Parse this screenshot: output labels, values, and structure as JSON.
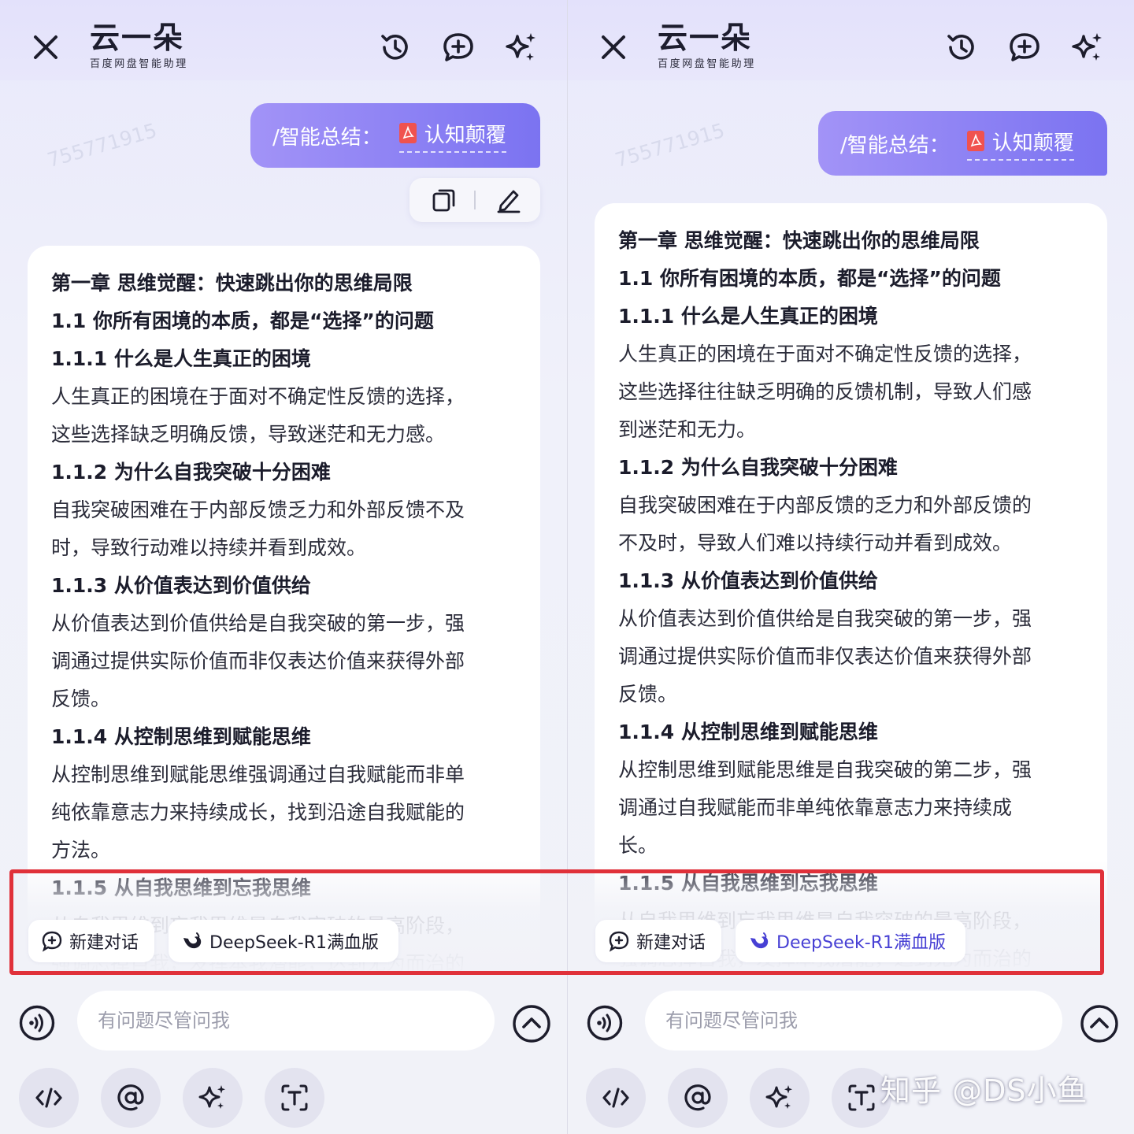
{
  "app": {
    "brand_name": "云一朵",
    "brand_subtitle": "百度网盘智能助理"
  },
  "colors": {
    "accent": "#7b73f1",
    "accent_light": "#a293f7",
    "deepseek_blue": "#4740d4",
    "highlight_border": "#e0313a"
  },
  "icons": {
    "close": "close-icon",
    "history": "history-icon",
    "new_chat": "chat-plus-icon",
    "sparkle": "sparkle-icon",
    "copy": "copy-icon",
    "edit": "pencil-icon",
    "pdf": "pdf-icon",
    "voice": "voice-icon",
    "expand": "chevron-up-icon",
    "code": "code-icon",
    "mention": "at-icon",
    "text_recognize": "text-scan-icon",
    "deepseek": "deepseek-whale-icon"
  },
  "left": {
    "user_message": {
      "command": "/智能总结：",
      "file_name": "认知颠覆"
    },
    "summary_lines": [
      {
        "text": "第一章 思维觉醒：快速跳出你的思维局限",
        "heading": true
      },
      {
        "text": "1.1 你所有困境的本质，都是“选择”的问题",
        "heading": true
      },
      {
        "text": "1.1.1 什么是人生真正的困境",
        "heading": true
      },
      {
        "text": "人生真正的困境在于面对不确定性反馈的选择，",
        "heading": false
      },
      {
        "text": "这些选择缺乏明确反馈，导致迷茫和无力感。",
        "heading": false
      },
      {
        "text": "1.1.2 为什么自我突破十分困难",
        "heading": true
      },
      {
        "text": "自我突破困难在于内部反馈乏力和外部反馈不及",
        "heading": false
      },
      {
        "text": "时，导致行动难以持续并看到成效。",
        "heading": false
      },
      {
        "text": "1.1.3 从价值表达到价值供给",
        "heading": true
      },
      {
        "text": "从价值表达到价值供给是自我突破的第一步，强",
        "heading": false
      },
      {
        "text": "调通过提供实际价值而非仅表达价值来获得外部",
        "heading": false
      },
      {
        "text": "反馈。",
        "heading": false
      },
      {
        "text": "1.1.4 从控制思维到赋能思维",
        "heading": true
      },
      {
        "text": "从控制思维到赋能思维强调通过自我赋能而非单",
        "heading": false
      },
      {
        "text": "纯依靠意志力来持续成长，找到沿途自我赋能的",
        "heading": false
      },
      {
        "text": "方法。",
        "heading": false
      },
      {
        "text": "1.1.5 从自我思维到忘我思维",
        "heading": true
      },
      {
        "text": "从自我思维到忘我思维是自我突破的最高阶段，",
        "heading": false
      },
      {
        "text": "强调忘掉自我，发挥本我潜能，达到无为而治的",
        "heading": false
      }
    ],
    "chips": {
      "new_chat": "新建对话",
      "model": "DeepSeek-R1满血版"
    },
    "input_placeholder": "有问题尽管问我"
  },
  "right": {
    "user_message": {
      "command": "/智能总结：",
      "file_name": "认知颠覆"
    },
    "summary_lines": [
      {
        "text": "第一章 思维觉醒：快速跳出你的思维局限",
        "heading": true
      },
      {
        "text": "1.1 你所有困境的本质，都是“选择”的问题",
        "heading": true
      },
      {
        "text": "1.1.1 什么是人生真正的困境",
        "heading": true
      },
      {
        "text": "人生真正的困境在于面对不确定性反馈的选择，",
        "heading": false
      },
      {
        "text": "这些选择往往缺乏明确的反馈机制，导致人们感",
        "heading": false
      },
      {
        "text": "到迷茫和无力。",
        "heading": false
      },
      {
        "text": "1.1.2 为什么自我突破十分困难",
        "heading": true
      },
      {
        "text": "自我突破困难在于内部反馈的乏力和外部反馈的",
        "heading": false
      },
      {
        "text": "不及时，导致人们难以持续行动并看到成效。",
        "heading": false
      },
      {
        "text": "1.1.3 从价值表达到价值供给",
        "heading": true
      },
      {
        "text": "从价值表达到价值供给是自我突破的第一步，强",
        "heading": false
      },
      {
        "text": "调通过提供实际价值而非仅表达价值来获得外部",
        "heading": false
      },
      {
        "text": "反馈。",
        "heading": false
      },
      {
        "text": "1.1.4 从控制思维到赋能思维",
        "heading": true
      },
      {
        "text": "从控制思维到赋能思维是自我突破的第二步，强",
        "heading": false
      },
      {
        "text": "调通过自我赋能而非单纯依靠意志力来持续成",
        "heading": false
      },
      {
        "text": "长。",
        "heading": false
      },
      {
        "text": "1.1.5 从自我思维到忘我思维",
        "heading": true
      },
      {
        "text": "从自我思维到忘我思维是自我突破的最高阶段，",
        "heading": false
      },
      {
        "text": "强调忘掉自我，发挥本我潜能，达到无为而治的",
        "heading": false
      }
    ],
    "chips": {
      "new_chat": "新建对话",
      "model": "DeepSeek-R1满血版"
    },
    "input_placeholder": "有问题尽管问我"
  },
  "watermark_text": "755771915",
  "overlay_credit": "知乎 @DS小鱼"
}
